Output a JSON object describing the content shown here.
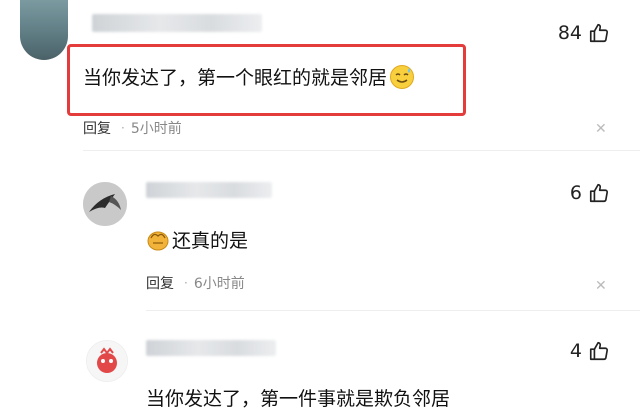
{
  "comments": [
    {
      "likes": "84",
      "text": "当你发达了，第一个眼红的就是邻居",
      "emoji": "smile-sweat-emoji",
      "reply_label": "回复",
      "time": "5小时前"
    },
    {
      "likes": "6",
      "text": "还真的是",
      "emoji": "hands-emoji",
      "reply_label": "回复",
      "time": "6小时前"
    },
    {
      "likes": "4",
      "text": "当你发达了，第一件事就是欺负邻居"
    }
  ],
  "colors": {
    "highlight": "#e43b3b",
    "meta": "#888888"
  }
}
